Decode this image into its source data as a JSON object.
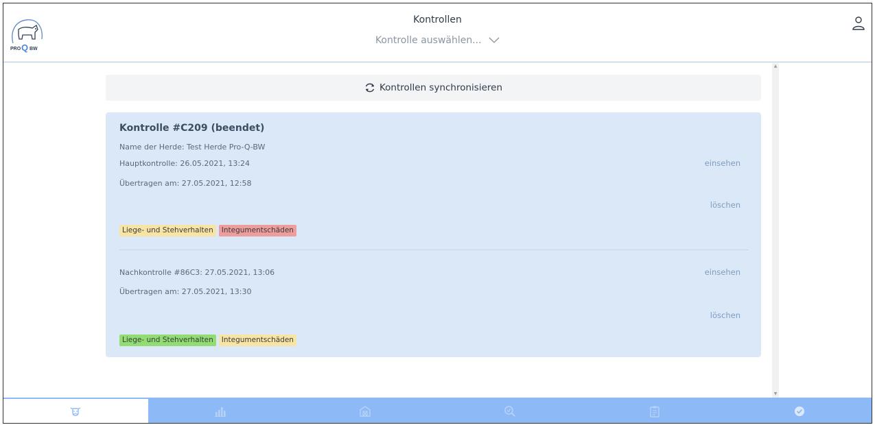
{
  "header": {
    "title": "Kontrollen",
    "select_label": "Kontrolle auswählen...",
    "logo_text_left": "PRO",
    "logo_text_q": "Q",
    "logo_text_right": "BW"
  },
  "sync": {
    "label": "Kontrollen synchronisieren"
  },
  "card": {
    "title": "Kontrolle #C209 (beendet)",
    "herd": "Name der Herde: Test Herde Pro-Q-BW",
    "main_control": "Hauptkontrolle: 26.05.2021, 13:24",
    "transferred": "Übertragen am: 27.05.2021, 12:58",
    "view_label": "einsehen",
    "delete_label": "löschen",
    "tags": [
      {
        "label": "Liege- und Stehverhalten",
        "color": "#f8e5a6"
      },
      {
        "label": "Integumentschäden",
        "color": "#ee9d9d"
      }
    ],
    "followup": {
      "line": "Nachkontrolle #86C3: 27.05.2021, 13:06",
      "transferred": "Übertragen am: 27.05.2021, 13:30",
      "view_label": "einsehen",
      "delete_label": "löschen",
      "tags": [
        {
          "label": "Liege- und Stehverhalten",
          "color": "#91dd74"
        },
        {
          "label": "Integumentschäden",
          "color": "#f8e5a6"
        }
      ]
    }
  },
  "bottom_nav": {
    "items": [
      {
        "icon": "cow-icon",
        "active": true
      },
      {
        "icon": "bar-chart-icon",
        "active": false
      },
      {
        "icon": "barn-icon",
        "active": false
      },
      {
        "icon": "search-check-icon",
        "active": false
      },
      {
        "icon": "clipboard-icon",
        "active": false
      },
      {
        "icon": "check-circle-icon",
        "active": false
      }
    ]
  },
  "colors": {
    "accent": "#8dbaf7",
    "card_bg": "#dbe8f7",
    "link": "#7f9dbf"
  }
}
